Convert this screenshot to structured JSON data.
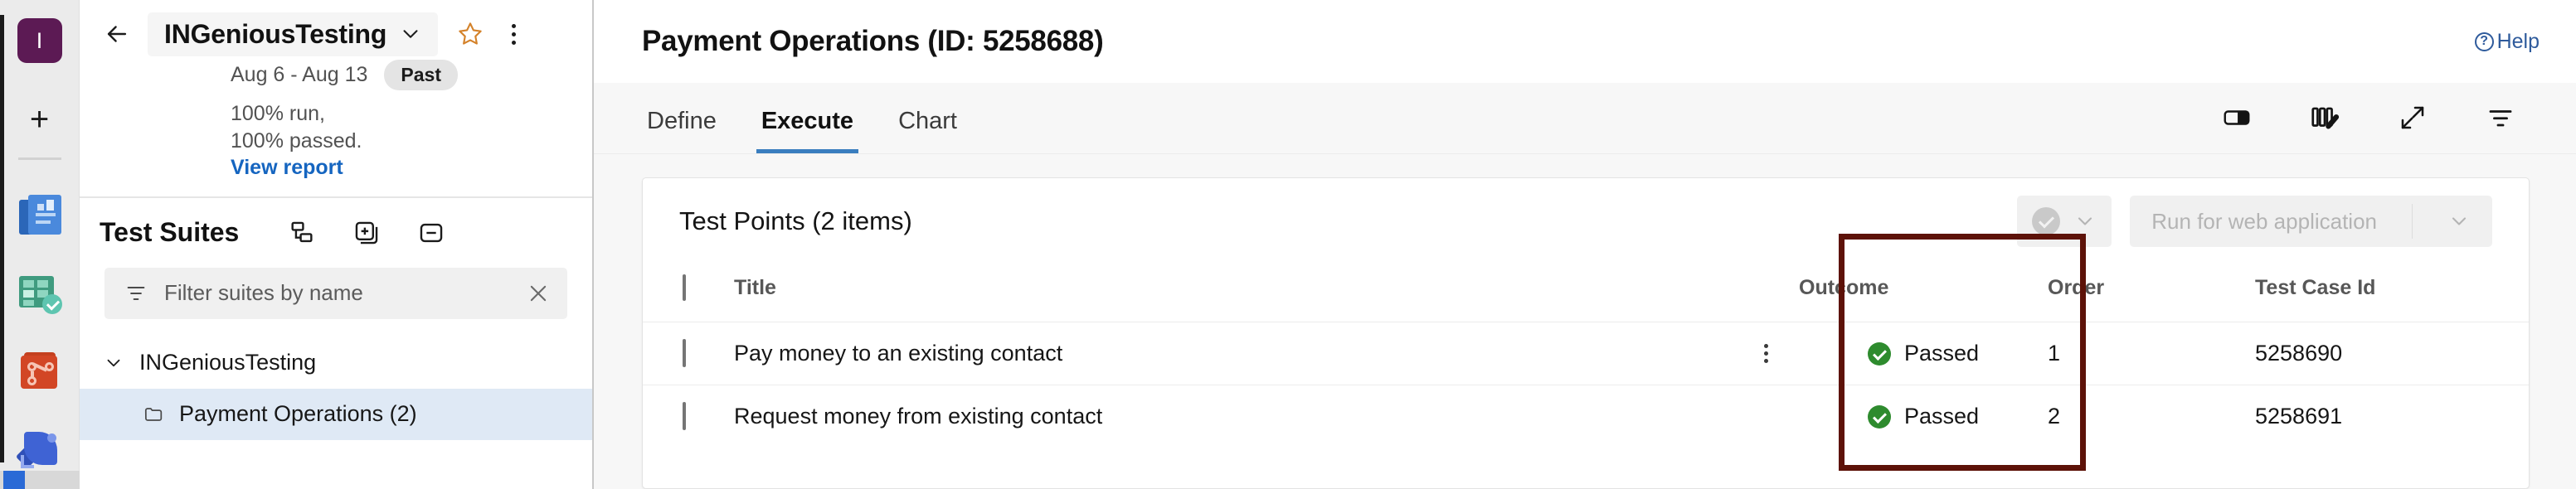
{
  "rail": {
    "avatar_label": "I",
    "add_label": "+",
    "icons": [
      {
        "name": "word-app-icon"
      },
      {
        "name": "excel-app-icon"
      },
      {
        "name": "repos-app-icon"
      },
      {
        "name": "azure-devops-app-icon"
      }
    ]
  },
  "side": {
    "back_label": "←",
    "plan_name": "INGeniousTesting",
    "plan_chevron": "⌄",
    "star_title": "Favorite",
    "date_range": "Aug 6 - Aug 13",
    "status_badge": "Past",
    "stats_text": "100% run, 100% passed. ",
    "stats_link": "View report",
    "suites_title": "Test Suites",
    "suite_actions": [
      "show-test-plan-hierarchy",
      "expand-all",
      "collapse-all"
    ],
    "filter_placeholder": "Filter suites by name",
    "filter_value": "",
    "tree": [
      {
        "label": "INGeniousTesting",
        "level": 0,
        "expanded": true,
        "selected": false
      },
      {
        "label": "Payment Operations (2)",
        "level": 1,
        "expanded": false,
        "selected": true
      }
    ]
  },
  "main": {
    "title": "Payment Operations (ID: 5258688)",
    "help_label": "Help",
    "tabs": [
      {
        "label": "Define",
        "active": false
      },
      {
        "label": "Execute",
        "active": true
      },
      {
        "label": "Chart",
        "active": false
      }
    ],
    "toolbar_icons": [
      "split-pane-icon",
      "column-options-icon",
      "fullscreen-icon",
      "filter-icon"
    ],
    "card_title": "Test Points (2 items)",
    "outcome_button_label": "",
    "run_button_label": "Run for web application",
    "columns": [
      "",
      "Title",
      "",
      "Outcome",
      "Order",
      "Test Case Id"
    ],
    "rows": [
      {
        "checked": false,
        "title": "Pay money to an existing contact",
        "outcome": "Passed",
        "order": "1",
        "test_case_id": "5258690",
        "show_kebab": true
      },
      {
        "checked": false,
        "title": "Request money from existing contact",
        "outcome": "Passed",
        "order": "2",
        "test_case_id": "5258691",
        "show_kebab": false
      }
    ]
  },
  "annotation": {
    "color": "#5d1208",
    "target": "outcome-column"
  }
}
